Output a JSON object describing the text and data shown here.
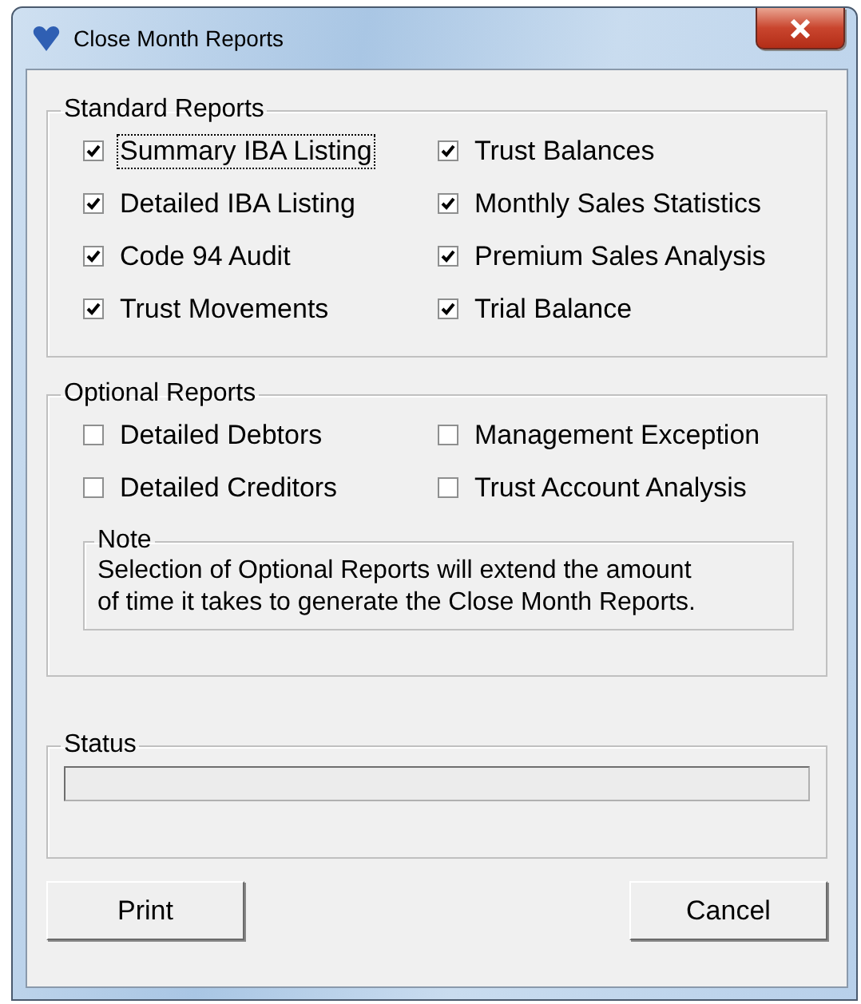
{
  "window": {
    "title": "Close Month Reports"
  },
  "standard_reports": {
    "title": "Standard Reports",
    "items": [
      {
        "label": "Summary IBA Listing",
        "checked": true,
        "focused": true
      },
      {
        "label": "Trust Balances",
        "checked": true,
        "focused": false
      },
      {
        "label": "Detailed IBA Listing",
        "checked": true,
        "focused": false
      },
      {
        "label": "Monthly Sales Statistics",
        "checked": true,
        "focused": false
      },
      {
        "label": "Code 94 Audit",
        "checked": true,
        "focused": false
      },
      {
        "label": "Premium Sales Analysis",
        "checked": true,
        "focused": false
      },
      {
        "label": "Trust Movements",
        "checked": true,
        "focused": false
      },
      {
        "label": "Trial Balance",
        "checked": true,
        "focused": false
      }
    ]
  },
  "optional_reports": {
    "title": "Optional Reports",
    "items": [
      {
        "label": "Detailed Debtors",
        "checked": false,
        "focused": false
      },
      {
        "label": "Management Exception",
        "checked": false,
        "focused": false
      },
      {
        "label": "Detailed Creditors",
        "checked": false,
        "focused": false
      },
      {
        "label": "Trust Account Analysis",
        "checked": false,
        "focused": false
      }
    ],
    "note": {
      "title": "Note",
      "text": "Selection of Optional Reports will extend the amount of time it takes to generate the Close Month Reports."
    }
  },
  "status": {
    "title": "Status",
    "progress": {
      "level": 0
    }
  },
  "buttons": [
    "Print",
    "Cancel"
  ]
}
